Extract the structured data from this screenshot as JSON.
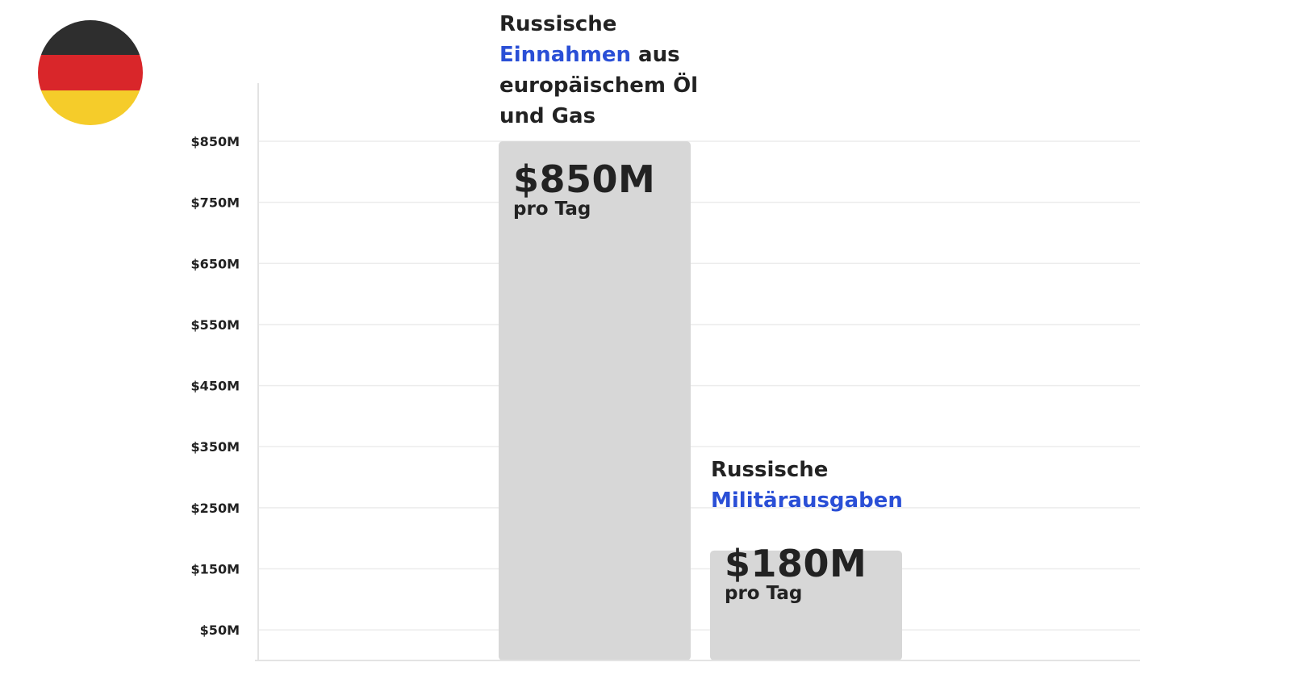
{
  "flag": {
    "name": "germany-flag",
    "colors": [
      "#2e2e2e",
      "#d9262a",
      "#f5cc2a"
    ]
  },
  "chart_data": {
    "type": "bar",
    "categories": [
      "Russische Einnahmen aus europäischem Öl und Gas",
      "Russische Militärausgaben"
    ],
    "values": [
      850,
      180
    ],
    "unit": "$M pro Tag",
    "ylim": [
      0,
      950
    ],
    "yticks": [
      850,
      750,
      650,
      550,
      450,
      350,
      250,
      150,
      50
    ],
    "ytick_labels": [
      "$850M",
      "$750M",
      "$650M",
      "$550M",
      "$450M",
      "$350M",
      "$250M",
      "$150M",
      "$50M"
    ],
    "grid": true,
    "bar_color": "#d7d7d7",
    "accent_color": "#2a4fd6",
    "bars": [
      {
        "caption": [
          "Russische ",
          "Einnahmen",
          " aus europäischem Öl und Gas"
        ],
        "value_label": "$850M",
        "unit_label": "pro Tag"
      },
      {
        "caption": [
          "Russische ",
          "Militärausgaben",
          ""
        ],
        "value_label": "$180M",
        "unit_label": "pro Tag"
      }
    ]
  }
}
